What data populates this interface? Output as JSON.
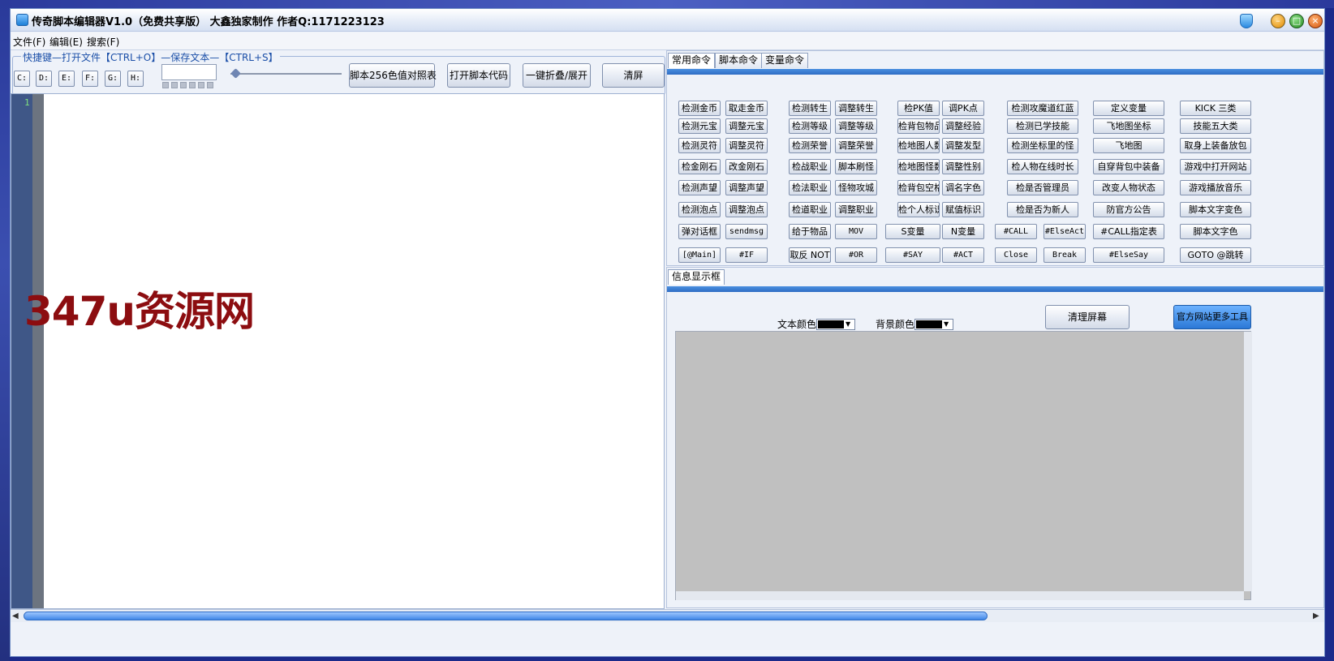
{
  "window": {
    "title": "传奇脚本编辑器V1.0（免费共享版）  大鑫独家制作  作者Q:1171223123"
  },
  "menu": [
    "文件(F)",
    "编辑(E)",
    "搜索(F)"
  ],
  "shortcut_legend": "快捷键—打开文件【CTRL+O】—保存文本—【CTRL+S】",
  "drives": [
    "C:",
    "D:",
    "E:",
    "F:",
    "G:",
    "H:"
  ],
  "toolbar": {
    "color_table": "脚本256色值对照表",
    "open_code": "打开脚本代码",
    "fold_toggle": "一键折叠/展开",
    "clear": "清屏"
  },
  "editor": {
    "line_number": "1",
    "watermark": "347u资源网"
  },
  "tabs": {
    "cmd": [
      "常用命令",
      "脚本命令",
      "变量命令"
    ],
    "info": "信息显示框"
  },
  "commands": [
    [
      "检测金币",
      "取走金币",
      "检测转生",
      "调整转生",
      "检PK值",
      "调PK点",
      "检测攻魔道红蓝",
      "定义变量",
      "KICK 三类"
    ],
    [
      "检测元宝",
      "调整元宝",
      "检测等级",
      "调整等级",
      "检背包物品",
      "调整经验",
      "检测已学技能",
      "飞地图坐标",
      "技能五大类"
    ],
    [
      "检测灵符",
      "调整灵符",
      "检测荣誉",
      "调整荣誉",
      "检地图人数",
      "调整发型",
      "检测坐标里的怪",
      "飞地图",
      "取身上装备放包"
    ],
    [
      "检金刚石",
      "改金刚石",
      "检战职业",
      "脚本刷怪",
      "检地图怪数",
      "调整性别",
      "检人物在线时长",
      "自穿背包中装备",
      "游戏中打开网站"
    ],
    [
      "检测声望",
      "调整声望",
      "检法职业",
      "怪物攻城",
      "检背包空格",
      "调名字色",
      "检是否管理员",
      "改变人物状态",
      "游戏播放音乐"
    ],
    [
      "检测泡点",
      "调整泡点",
      "检道职业",
      "调整职业",
      "检个人标识",
      "赋值标识",
      "检是否为新人",
      "防官方公告",
      "脚本文字变色"
    ],
    [
      "弹对话框",
      "sendmsg",
      "给于物品",
      "MOV",
      "S变量",
      "N变量",
      "#CALL",
      "#ElseAct",
      "#CALL指定表",
      "脚本文字色"
    ],
    [
      "[@Main]",
      "#IF",
      "取反 NOT",
      "#OR",
      "#SAY",
      "#ACT",
      "Close",
      "Break",
      "#ElseSay",
      "GOTO @跳转"
    ]
  ],
  "info": {
    "text_color_label": "文本颜色",
    "bg_color_label": "背景颜色",
    "clear_screen": "清理屏幕",
    "official_tools": "官方网站更多工具"
  },
  "colors": {
    "accent": "#2e6cc4",
    "watermark": "#8c0d10",
    "gutter": "#3f5787",
    "display_bg": "#c0c0c0"
  }
}
